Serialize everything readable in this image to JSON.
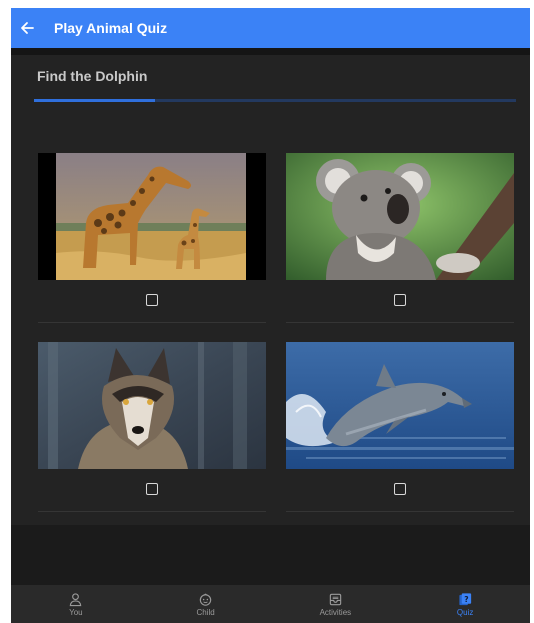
{
  "appbar": {
    "title": "Play Animal Quiz",
    "back_icon": "arrow-left-icon"
  },
  "quiz": {
    "prompt": "Find the Dolphin",
    "progress": 0.25,
    "options": [
      {
        "animal": "giraffe",
        "checked": false
      },
      {
        "animal": "koala",
        "checked": false
      },
      {
        "animal": "wolf",
        "checked": false
      },
      {
        "animal": "dolphin",
        "checked": false
      }
    ]
  },
  "nav": {
    "items": [
      {
        "label": "You",
        "icon": "person-icon",
        "active": false
      },
      {
        "label": "Child",
        "icon": "child-face-icon",
        "active": false
      },
      {
        "label": "Activities",
        "icon": "inbox-icon",
        "active": false
      },
      {
        "label": "Quiz",
        "icon": "quiz-icon",
        "active": true
      }
    ]
  },
  "colors": {
    "accent": "#3b82f6",
    "background": "#1e1e1e",
    "card": "#232323"
  }
}
